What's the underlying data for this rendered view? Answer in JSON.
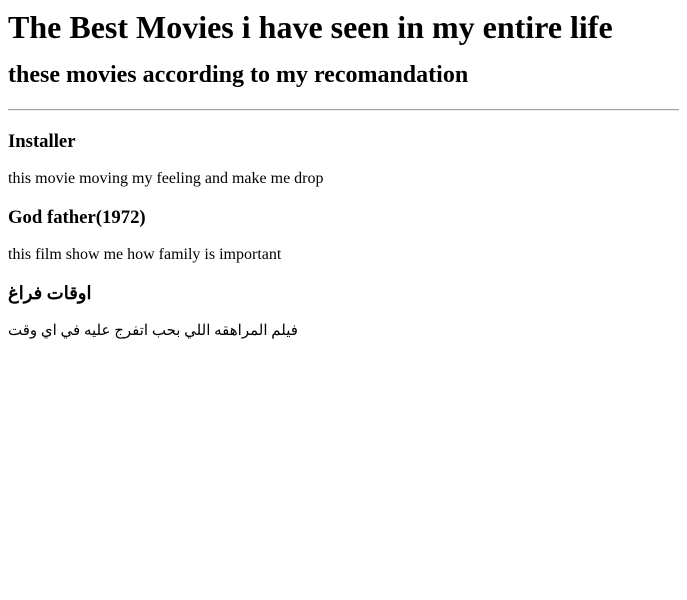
{
  "page": {
    "title": "The Best Movies i have seen in my entire life",
    "subtitle": "these movies according to my recomandation"
  },
  "movies": [
    {
      "title": "Installer",
      "description": "this movie moving my feeling and make me drop"
    },
    {
      "title": "God father(1972)",
      "description": "this film show me how family is important"
    },
    {
      "title": "اوقات فراغ",
      "description": "فيلم المراهقه اللي بحب اتفرج عليه في اي وقت"
    }
  ]
}
